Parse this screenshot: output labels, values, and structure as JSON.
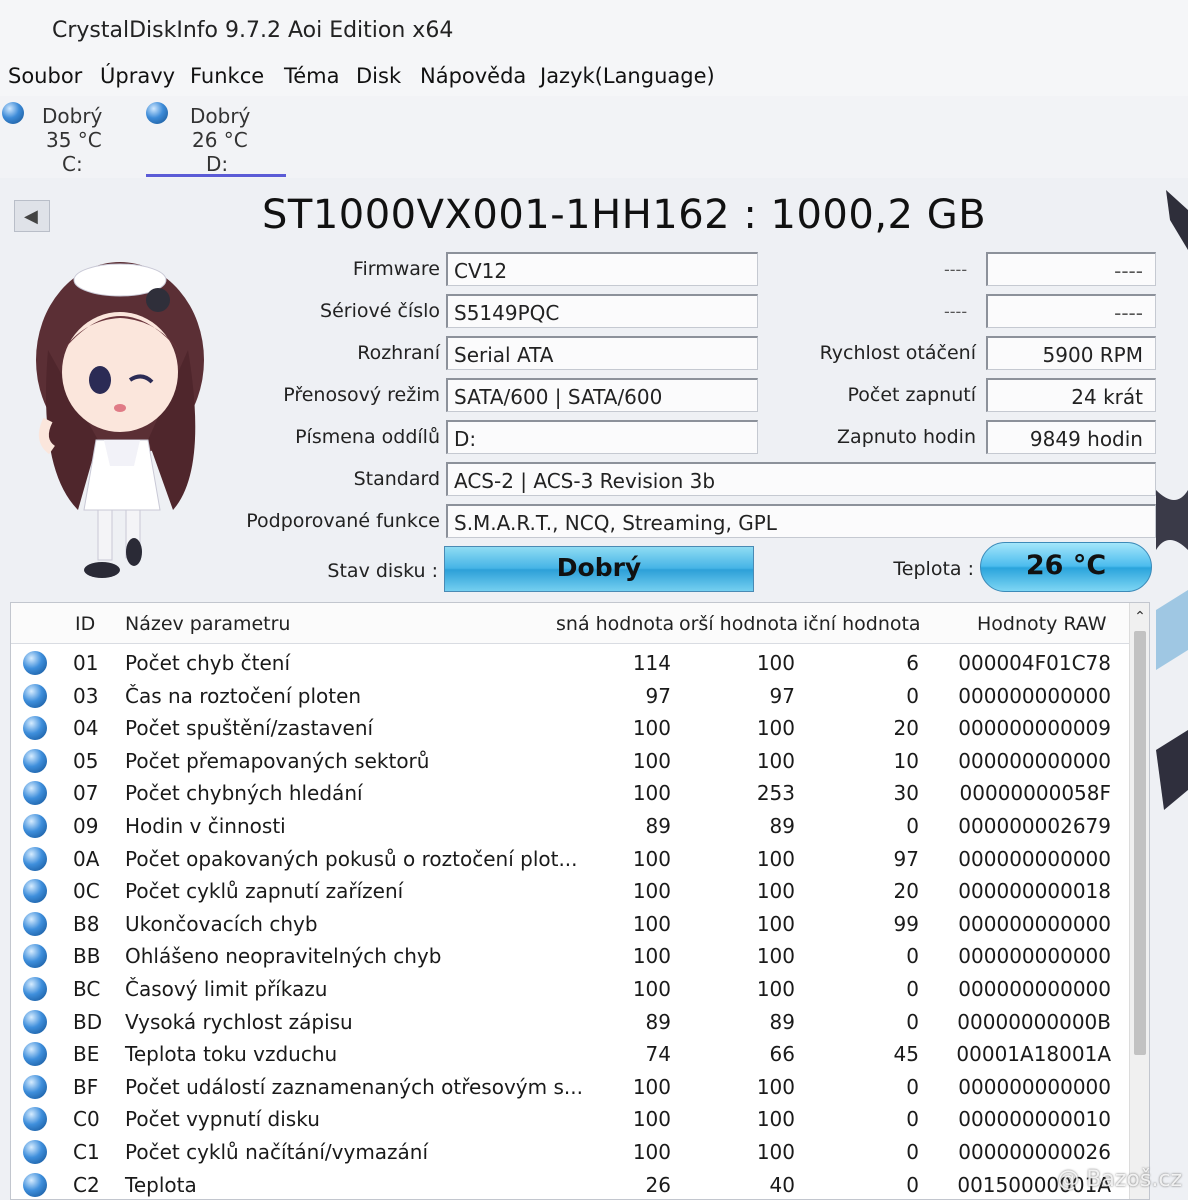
{
  "window": {
    "title": "CrystalDiskInfo 9.7.2 Aoi Edition x64"
  },
  "menu": [
    "Soubor",
    "Úpravy",
    "Funkce",
    "Téma",
    "Disk",
    "Nápověda",
    "Jazyk(Language)"
  ],
  "drives": [
    {
      "status": "Dobrý",
      "temp": "35 °C",
      "letter": "C:"
    },
    {
      "status": "Dobrý",
      "temp": "26 °C",
      "letter": "D:"
    }
  ],
  "disk": {
    "model": "ST1000VX001-1HH162 : 1000,2 GB",
    "fields": {
      "firmware_label": "Firmware",
      "firmware": "CV12",
      "serial_label": "Sériové číslo",
      "serial": "S5149PQC",
      "interface_label": "Rozhraní",
      "interface": "Serial ATA",
      "transfer_label": "Přenosový režim",
      "transfer": "SATA/600 | SATA/600",
      "letters_label": "Písmena oddílů",
      "letters": "D:",
      "standard_label": "Standard",
      "standard": "ACS-2 | ACS-3 Revision 3b",
      "features_label": "Podporované funkce",
      "features": "S.M.A.R.T., NCQ, Streaming, GPL",
      "rpm_label": "Rychlost otáčení",
      "rpm": "5900 RPM",
      "power_count_label": "Počet zapnutí",
      "power_count": "24 krát",
      "power_hours_label": "Zapnuto hodin",
      "power_hours": "9849 hodin",
      "dash": "----"
    },
    "health_label": "Stav disku :",
    "health": "Dobrý",
    "temp_label": "Teplota :",
    "temp": "26 °C"
  },
  "smart": {
    "headers": [
      "ID",
      "Název parametru",
      "sná hodnota",
      "orší hodnota",
      "iční hodnota",
      "Hodnoty RAW"
    ],
    "rows": [
      [
        "01",
        "Počet chyb čtení",
        "114",
        "100",
        "6",
        "000004F01C78"
      ],
      [
        "03",
        "Čas na roztočení ploten",
        "97",
        "97",
        "0",
        "000000000000"
      ],
      [
        "04",
        "Počet spuštění/zastavení",
        "100",
        "100",
        "20",
        "000000000009"
      ],
      [
        "05",
        "Počet přemapovaných sektorů",
        "100",
        "100",
        "10",
        "000000000000"
      ],
      [
        "07",
        "Počet chybných hledání",
        "100",
        "253",
        "30",
        "00000000058F"
      ],
      [
        "09",
        "Hodin v činnosti",
        "89",
        "89",
        "0",
        "000000002679"
      ],
      [
        "0A",
        "Počet opakovaných pokusů o roztočení plot...",
        "100",
        "100",
        "97",
        "000000000000"
      ],
      [
        "0C",
        "Počet cyklů zapnutí zařízení",
        "100",
        "100",
        "20",
        "000000000018"
      ],
      [
        "B8",
        "Ukončovacích chyb",
        "100",
        "100",
        "99",
        "000000000000"
      ],
      [
        "BB",
        "Ohlášeno neopravitelných chyb",
        "100",
        "100",
        "0",
        "000000000000"
      ],
      [
        "BC",
        "Časový limit příkazu",
        "100",
        "100",
        "0",
        "000000000000"
      ],
      [
        "BD",
        "Vysoká rychlost zápisu",
        "89",
        "89",
        "0",
        "00000000000B"
      ],
      [
        "BE",
        "Teplota toku vzduchu",
        "74",
        "66",
        "45",
        "00001A18001A"
      ],
      [
        "BF",
        "Počet událostí zaznamenaných otřesovým s...",
        "100",
        "100",
        "0",
        "000000000000"
      ],
      [
        "C0",
        "Počet vypnutí disku",
        "100",
        "100",
        "0",
        "000000000010"
      ],
      [
        "C1",
        "Počet cyklů načítání/vymazání",
        "100",
        "100",
        "0",
        "000000000026"
      ],
      [
        "C2",
        "Teplota",
        "26",
        "40",
        "0",
        "00150000001A"
      ]
    ]
  },
  "watermark": "@ Bazoš.cz",
  "colors": {
    "status_blue": "#2da0d8",
    "dot_blue": "#3f8fdc",
    "accent": "#5b5bd6"
  }
}
